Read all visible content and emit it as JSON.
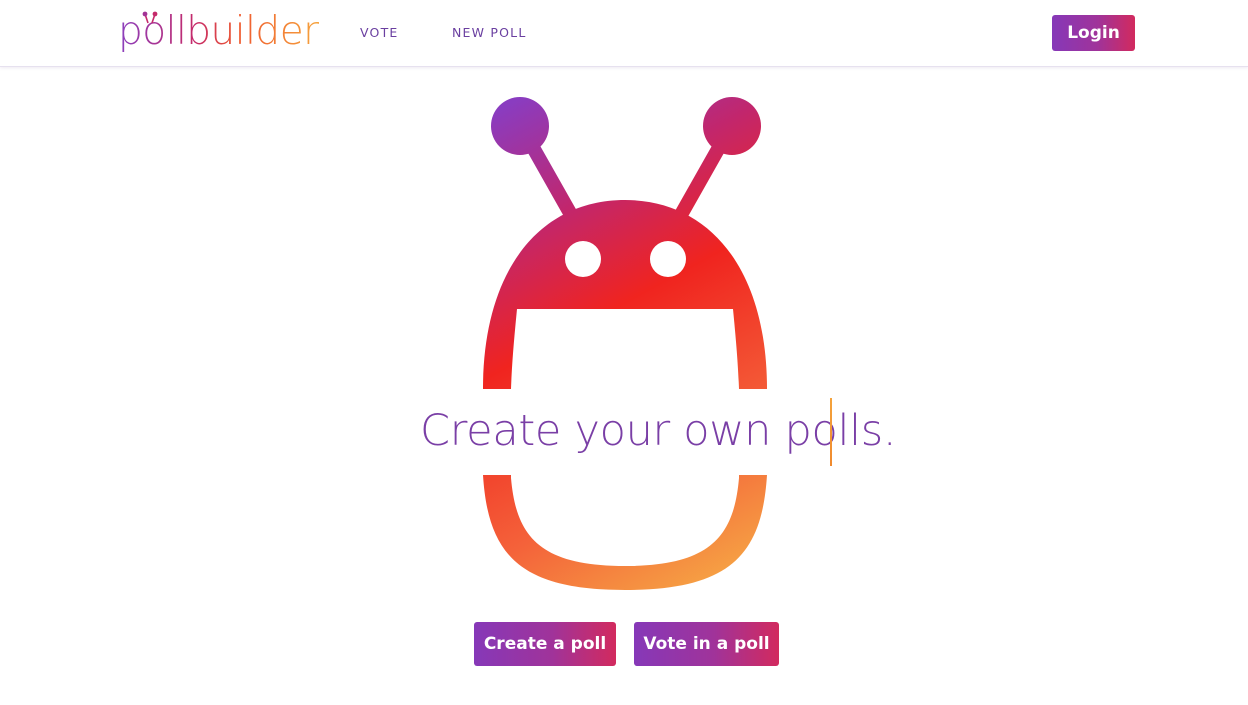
{
  "header": {
    "logo_text": "pollbuilder",
    "nav": [
      {
        "label": "VOTE"
      },
      {
        "label": "NEW POLL"
      }
    ],
    "login_label": "Login"
  },
  "hero": {
    "headline": "Create your own polls.",
    "mascot_icon": "robot-mascot-icon"
  },
  "actions": {
    "create_label": "Create a poll",
    "vote_label": "Vote in a poll"
  },
  "colors": {
    "purple": "#8638b8",
    "magenta": "#c52a6a",
    "red": "#f0241f",
    "orange": "#f6a43d",
    "nav_text": "#6a3fa0"
  }
}
